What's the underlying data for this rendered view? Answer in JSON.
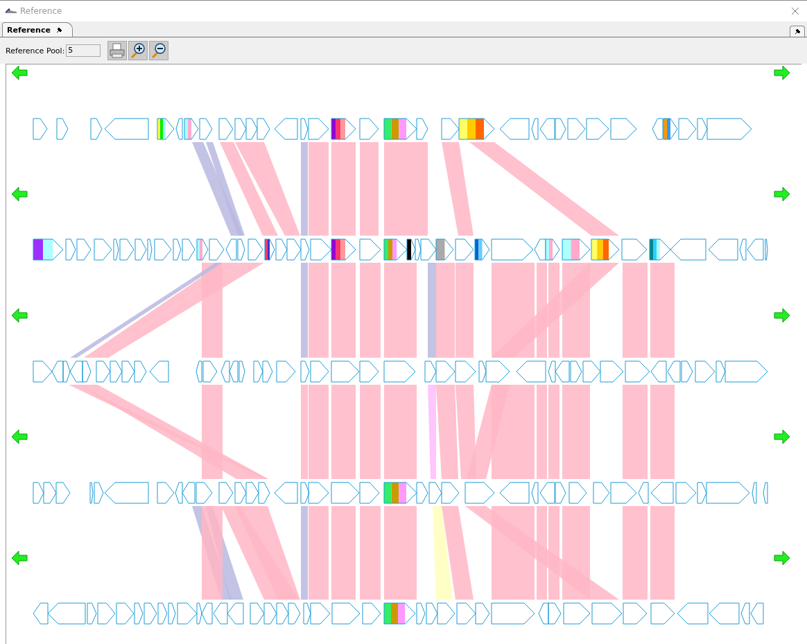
{
  "window": {
    "title": "Reference"
  },
  "tabs": [
    {
      "label": "Reference",
      "selected": true
    }
  ],
  "toolbar": {
    "pool_label": "Reference Pool:",
    "pool_value": "5"
  }
}
